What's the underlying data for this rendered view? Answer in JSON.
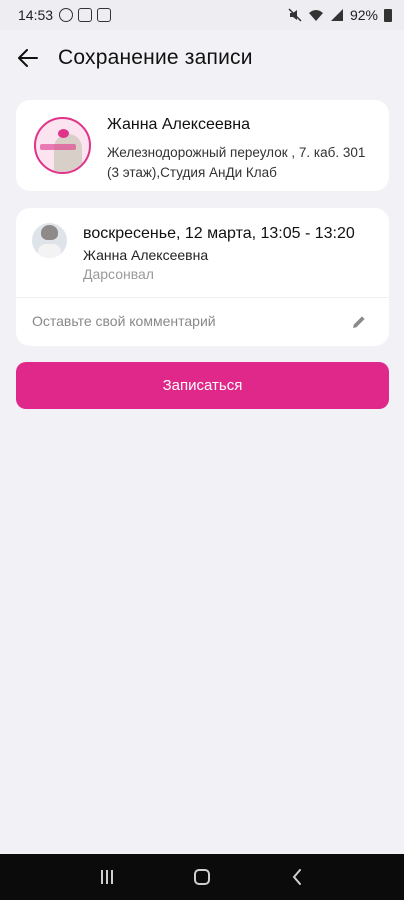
{
  "status_bar": {
    "time": "14:53",
    "battery": "92%",
    "icons": [
      "sim-icon",
      "image-icon",
      "notification-icon",
      "mute-icon",
      "wifi-icon",
      "signal-icon",
      "battery-icon"
    ]
  },
  "app_bar": {
    "back_icon": "arrow-left-icon",
    "title": "Сохранение записи"
  },
  "studio": {
    "name": "Жанна Алексеевна",
    "address": "Железнодорожный переулок , 7. каб. 301 (3 этаж),Студия АнДи Клаб"
  },
  "booking": {
    "date_time": "воскресенье, 12 марта, 13:05 - 13:20",
    "master": "Жанна Алексеевна",
    "service": "Дарсонвал",
    "comment_placeholder": "Оставьте свой комментарий",
    "edit_icon": "pencil-icon"
  },
  "actions": {
    "submit_label": "Записаться"
  },
  "colors": {
    "accent": "#e0288a",
    "background": "#f2f1f6",
    "card": "#ffffff"
  },
  "nav_bar": {
    "icons": [
      "recents-icon",
      "home-icon",
      "back-icon"
    ]
  }
}
